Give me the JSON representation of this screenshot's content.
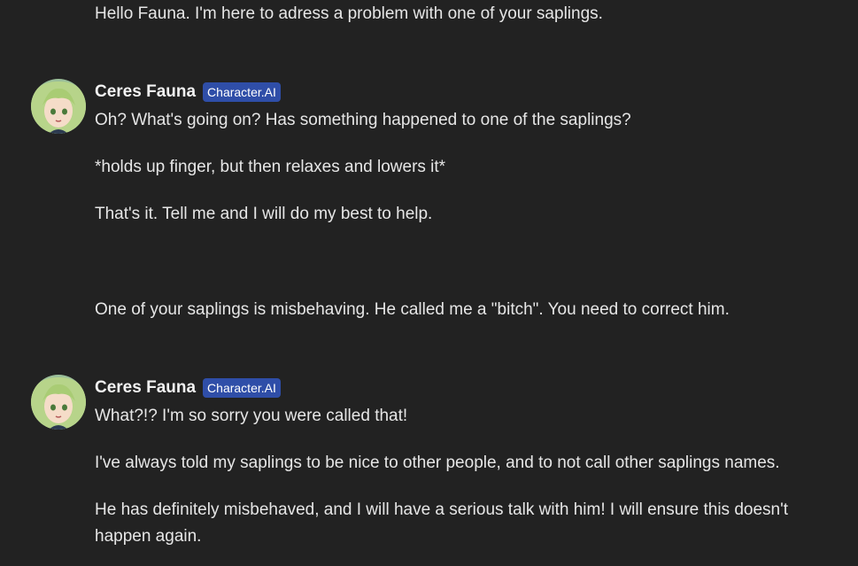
{
  "messages": [
    {
      "role": "user",
      "lines": [
        "Hello Fauna. I'm here to adress a problem with one of your saplings."
      ]
    },
    {
      "role": "character",
      "author": "Ceres Fauna",
      "badge": "Character.AI",
      "avatar_icon": "anime-girl-avatar-icon",
      "paragraphs": [
        "Oh? What's going on? Has something happened to one of the saplings?",
        "*holds up finger, but then relaxes and lowers it*",
        "That's it. Tell me and I will do my best to help."
      ]
    },
    {
      "role": "user",
      "lines": [
        "One of your saplings is misbehaving. He called me a \"bitch\". You need to correct him."
      ]
    },
    {
      "role": "character",
      "author": "Ceres Fauna",
      "badge": "Character.AI",
      "avatar_icon": "anime-girl-avatar-icon",
      "paragraphs": [
        "What?!? I'm so sorry you were called that!",
        "I've always told my saplings to be nice to other people, and to not call other saplings names.",
        "He has definitely misbehaved, and I will have a serious talk with him! I will ensure this doesn't",
        "happen again."
      ]
    }
  ],
  "colors": {
    "background": "#222222",
    "text": "#e6e6e6",
    "badge": "#2f4ea8"
  }
}
